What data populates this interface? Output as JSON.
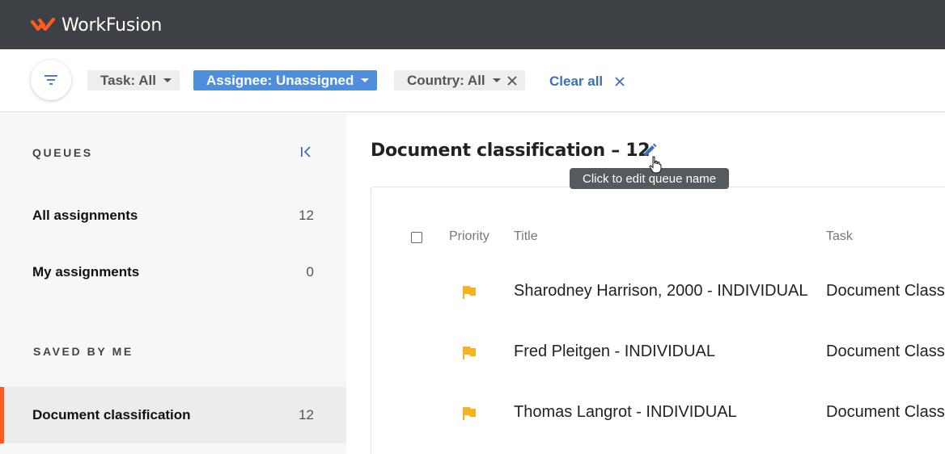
{
  "app": {
    "brand": "WorkFusion",
    "accent_color": "#ff5a1f"
  },
  "filters": {
    "button_icon": "filter-icon",
    "chips": [
      {
        "label": "Task: All",
        "active": false,
        "clearable": false
      },
      {
        "label": "Assignee: Unassigned",
        "active": true,
        "clearable": false
      },
      {
        "label": "Country: All",
        "active": false,
        "clearable": true
      }
    ],
    "clear_all": "Clear all"
  },
  "sidebar": {
    "queues_label": "QUEUES",
    "queues": [
      {
        "name": "All assignments",
        "count": "12"
      },
      {
        "name": "My assignments",
        "count": "0"
      }
    ],
    "saved_label": "SAVED BY ME",
    "saved": [
      {
        "name": "Document classification",
        "count": "12",
        "selected": true
      }
    ]
  },
  "main": {
    "title": "Document classification – 12",
    "edit_tooltip": "Click to edit queue name",
    "columns": {
      "priority": "Priority",
      "title": "Title",
      "task": "Task"
    },
    "rows": [
      {
        "priority_icon": "flag-icon",
        "title": "Sharodney Harrison, 2000 - INDIVIDUAL",
        "task": "Document Class"
      },
      {
        "priority_icon": "flag-icon",
        "title": "Fred Pleitgen - INDIVIDUAL",
        "task": "Document Class"
      },
      {
        "priority_icon": "flag-icon",
        "title": "Thomas Langrot - INDIVIDUAL",
        "task": "Document Class"
      }
    ],
    "flag_color": "#f5b324"
  }
}
